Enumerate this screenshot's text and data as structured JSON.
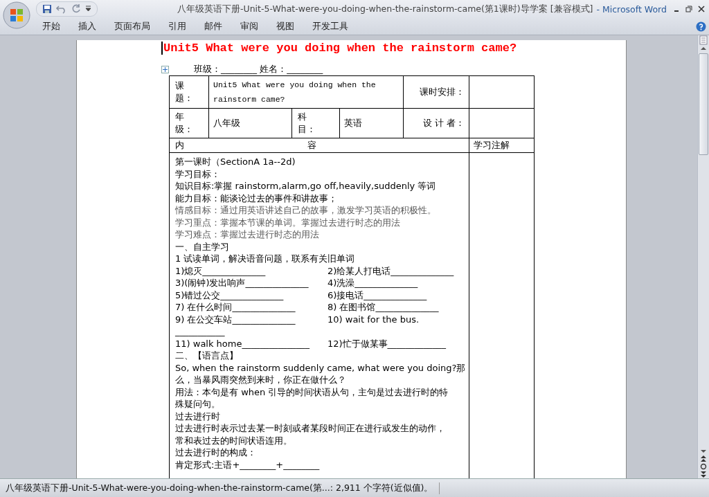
{
  "window": {
    "title": "八年级英语下册-Unit-5-What-were-you-doing-when-the-rainstorm-came(第1课时)导学案 [兼容模式]",
    "app": "- Microsoft Word"
  },
  "ribbon_tabs": [
    "开始",
    "插入",
    "页面布局",
    "引用",
    "邮件",
    "审阅",
    "视图",
    "开发工具"
  ],
  "document": {
    "heading": "Unit5 What were you doing when the rainstorm came?",
    "class_line": "班级：________ 姓名：________",
    "info_table": {
      "topic_label": "课题：",
      "topic": "Unit5 What were you doing when the rainstorm came?",
      "schedule_label": "课时安排：",
      "grade_label": "年级：",
      "grade": "八年级",
      "subject_label": "科目：",
      "subject": "英语",
      "designer_label": "设 计 者：",
      "content_header": [
        "内",
        "容"
      ],
      "notes_header": "学习注解"
    },
    "content": [
      {
        "kind": "text",
        "text": "第一课时（SectionA 1a--2d)"
      },
      {
        "kind": "text",
        "text": "学习目标："
      },
      {
        "kind": "text",
        "text": "知识目标:掌握 rainstorm,alarm,go off,heavily,suddenly 等词"
      },
      {
        "kind": "text",
        "text": "能力目标：能谈论过去的事件和讲故事；"
      },
      {
        "kind": "muted",
        "text": "情感目标：通过用英语讲述自己的故事，激发学习英语的积极性。"
      },
      {
        "kind": "muted",
        "text": "学习重点：掌握本节课的单词。掌握过去进行时态的用法"
      },
      {
        "kind": "muted",
        "text": "学习难点：掌握过去进行时态的用法"
      },
      {
        "kind": "text",
        "text": "一、自主学习"
      },
      {
        "kind": "text",
        "text": "1 试读单词，解决语音问题，联系有关旧单词"
      },
      {
        "kind": "pair",
        "items": [
          "1)熄灭______________",
          "2)给某人打电话______________"
        ]
      },
      {
        "kind": "pair",
        "items": [
          "3)(闹钟)发出响声______________",
          "4)洗澡______________"
        ]
      },
      {
        "kind": "pair",
        "items": [
          "5)错过公交______________",
          "6)接电话______________"
        ]
      },
      {
        "kind": "pair",
        "items": [
          "7) 在什么时间______________",
          "8) 在图书馆______________"
        ]
      },
      {
        "kind": "pair",
        "items": [
          "9) 在公交车站______________",
          "10) wait for the bus."
        ]
      },
      {
        "kind": "text",
        "text": "___________"
      },
      {
        "kind": "pair",
        "items": [
          "11)  walk home_______________",
          "12)忙于做某事_____________"
        ]
      },
      {
        "kind": "text",
        "text": "二、【语言点】"
      },
      {
        "kind": "text",
        "text": "So, when the rainstorm suddenly came, what were you doing?那"
      },
      {
        "kind": "text",
        "text": "么，当暴风雨突然到来时，你正在做什么？"
      },
      {
        "kind": "text",
        "text": "用法：本句是有 when 引导的时间状语从句，主句是过去进行时的特"
      },
      {
        "kind": "text",
        "text": "殊疑问句。"
      },
      {
        "kind": "text",
        "text": "过去进行时"
      },
      {
        "kind": "text",
        "text": "过去进行时表示过去某一时刻或者某段时间正在进行或发生的动作，"
      },
      {
        "kind": "text",
        "text": "常和表过去的时间状语连用。"
      },
      {
        "kind": "text",
        "text": "过去进行时的构成："
      },
      {
        "kind": "text",
        "text": "肯定形式:主语+________+________"
      }
    ]
  },
  "status_bar": "八年级英语下册-Unit-5-What-were-you-doing-when-the-rainstorm-came(第...: 2,911 个字符(近似值)。"
}
